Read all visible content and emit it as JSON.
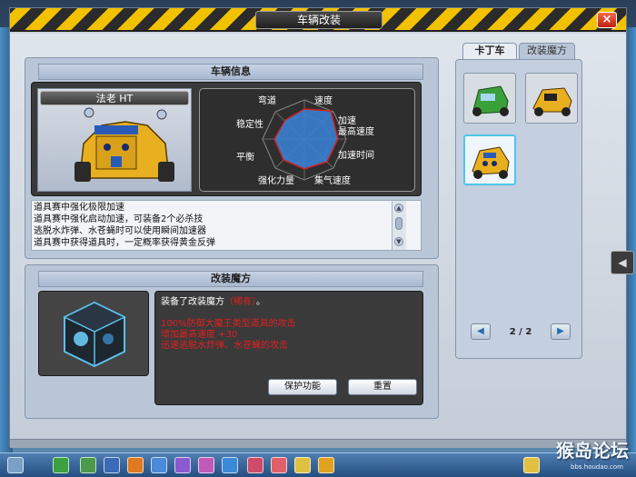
{
  "window": {
    "title": "车辆改装",
    "close_label": "×"
  },
  "vehicle_info": {
    "header": "车辆信息",
    "car_name": "法老 HT",
    "radar_labels": {
      "curve": "弯道",
      "speed": "速度",
      "accel": "加速",
      "top_speed": "最高速度",
      "stability": "稳定性",
      "accel_time": "加速时间",
      "balance": "平衡",
      "boost_power": "强化力量",
      "nitro_speed": "集气速度"
    },
    "description": [
      "道具赛中强化极限加速",
      "道具赛中强化启动加速，可装备2个必杀技",
      "逃脱水炸弹、水苍蝇时可以使用瞬间加速器",
      "道具赛中获得道具时，一定概率获得黄金反弹"
    ]
  },
  "mod_magic": {
    "header": "改装魔方",
    "equipped_prefix": "装备了改装魔方",
    "equipped_name": "（稀有）",
    "equipped_suffix": "。",
    "effects": [
      "100%防御大魔王类型道具的攻击",
      "增加最高速度 +30",
      "迅速逃脱水炸弹、水苍蝇的攻击"
    ],
    "protect_button": "保护功能",
    "reset_button": "重置"
  },
  "right_panel": {
    "tabs": [
      "卡丁车",
      "改装魔方"
    ],
    "active_tab": 0,
    "pager": {
      "current": 2,
      "total": 2,
      "separator": "/"
    },
    "prev_icon": "◀",
    "next_icon": "▶"
  },
  "side_tab_icon": "◀",
  "watermark": {
    "main": "猴岛论坛",
    "sub": "bbs.houdao.com"
  },
  "colors": {
    "title_stripe_yellow": "#f2c200",
    "title_stripe_black": "#2b2b2b",
    "effect_red": "#e02020",
    "rare_name": "#e02020",
    "radar_fill": "#3a7fd0",
    "selected_thumb_border": "#4cc6e8"
  }
}
